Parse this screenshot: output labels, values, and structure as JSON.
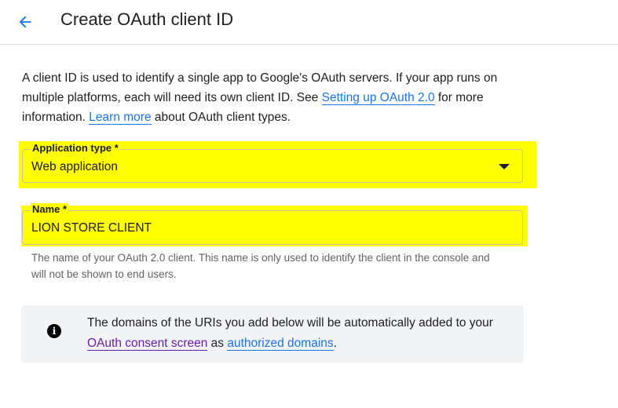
{
  "header": {
    "back_icon": "arrow-left-icon",
    "title": "Create OAuth client ID"
  },
  "intro": {
    "text_1": "A client ID is used to identify a single app to Google's OAuth servers. If your app runs on multiple platforms, each will need its own client ID. See ",
    "link_1": "Setting up OAuth 2.0",
    "text_2": " for more information. ",
    "link_2": "Learn more",
    "text_3": " about OAuth client types."
  },
  "form": {
    "application_type": {
      "label": "Application type *",
      "value": "Web application",
      "icon": "dropdown-arrow-icon"
    },
    "name": {
      "label": "Name *",
      "value": "LION STORE CLIENT",
      "helper": "The name of your OAuth 2.0 client. This name is only used to identify the client in the console and will not be shown to end users."
    }
  },
  "info": {
    "icon": "info-icon",
    "text_1": "The domains of the URIs you add below will be automatically added to your ",
    "link_1": "OAuth consent screen",
    "text_2": " as ",
    "link_2": "authorized domains",
    "text_3": "."
  },
  "colors": {
    "link": "#1a73e8",
    "link_visited": "#681da8",
    "highlight": "#ffff00",
    "info_bg": "#f1f3f4"
  }
}
